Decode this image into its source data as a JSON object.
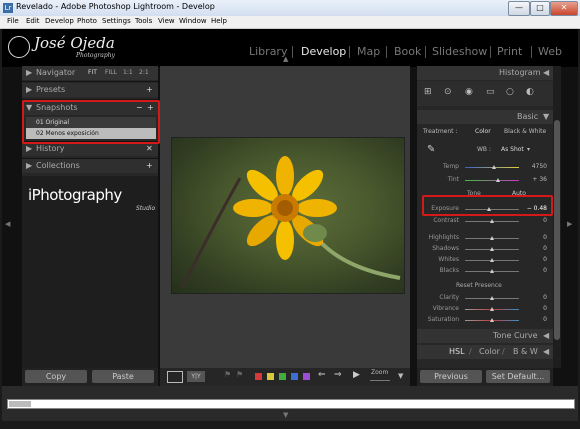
{
  "window": {
    "title": "Revelado - Adobe Photoshop Lightroom - Develop",
    "app_icon": "Lr",
    "minimize": "—",
    "maximize": "□",
    "close": "✕"
  },
  "menubar": [
    "File",
    "Edit",
    "Develop",
    "Photo",
    "Settings",
    "Tools",
    "View",
    "Window",
    "Help"
  ],
  "identity": {
    "name": "José Ojeda",
    "sub": "Photography",
    "logo_text": "iPhotography",
    "logo_sub": "Studio"
  },
  "modules": [
    {
      "label": "Library",
      "active": false
    },
    {
      "label": "Develop",
      "active": true
    },
    {
      "label": "Map",
      "active": false
    },
    {
      "label": "Book",
      "active": false
    },
    {
      "label": "Slideshow",
      "active": false
    },
    {
      "label": "Print",
      "active": false
    },
    {
      "label": "Web",
      "active": false
    }
  ],
  "left_panel": {
    "navigator": {
      "label": "Navigator",
      "zoom": [
        "FIT",
        "FILL",
        "1:1",
        "2:1"
      ]
    },
    "presets": {
      "label": "Presets",
      "action": "+"
    },
    "snapshots": {
      "label": "Snapshots",
      "minus": "−",
      "plus": "+",
      "items": [
        "01 Original",
        "02 Menos exposición"
      ]
    },
    "history": {
      "label": "History",
      "action": "✕"
    },
    "collections": {
      "label": "Collections",
      "action": "+"
    },
    "copy": "Copy",
    "paste": "Paste"
  },
  "right_panel": {
    "histogram": "Histogram",
    "basic": {
      "label": "Basic",
      "treatment_label": "Treatment :",
      "treatment_color": "Color",
      "treatment_bw": "Black & White",
      "wb_label": "WB :",
      "wb_value": "As Shot",
      "temp": {
        "label": "Temp",
        "value": "4750",
        "pos": 0.55
      },
      "tint": {
        "label": "Tint",
        "value": "+ 36",
        "pos": 0.62
      },
      "tone_label": "Tone",
      "auto": "Auto",
      "exposure": {
        "label": "Exposure",
        "value": "− 0.48",
        "pos": 0.45
      },
      "contrast": {
        "label": "Contrast",
        "value": "0",
        "pos": 0.5
      },
      "highlights": {
        "label": "Highlights",
        "value": "0",
        "pos": 0.5
      },
      "shadows": {
        "label": "Shadows",
        "value": "0",
        "pos": 0.5
      },
      "whites": {
        "label": "Whites",
        "value": "0",
        "pos": 0.5
      },
      "blacks": {
        "label": "Blacks",
        "value": "0",
        "pos": 0.5
      },
      "reset_presence": "Reset Presence",
      "clarity": {
        "label": "Clarity",
        "value": "0",
        "pos": 0.5
      },
      "vibrance": {
        "label": "Vibrance",
        "value": "0",
        "pos": 0.5
      },
      "saturation": {
        "label": "Saturation",
        "value": "0",
        "pos": 0.5
      }
    },
    "tone_curve": "Tone Curve",
    "hsl": "HSL",
    "color": "Color",
    "bw": "B & W",
    "previous": "Previous",
    "set_default": "Set Default..."
  },
  "toolbar": {
    "yy": "Y|Y",
    "zoom": "Zoom",
    "color_labels": [
      "#d23b3b",
      "#d6c93a",
      "#3fae3f",
      "#3b6fd2",
      "#9b4fd0"
    ]
  }
}
